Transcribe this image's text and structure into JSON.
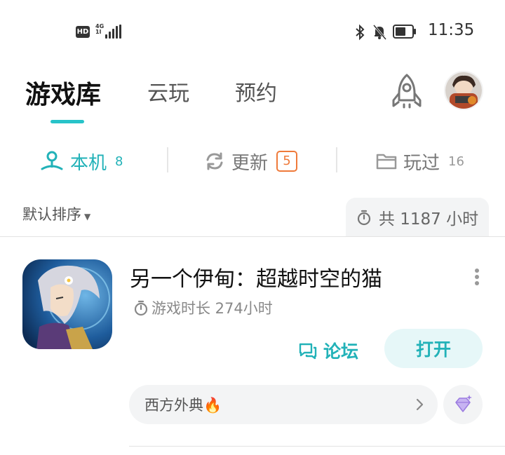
{
  "status_bar": {
    "hd_label": "HD",
    "network_label": "4G",
    "network_sub": "1l",
    "time": "11:35"
  },
  "top_tabs": [
    {
      "label": "游戏库",
      "active": true
    },
    {
      "label": "云玩",
      "active": false
    },
    {
      "label": "预约",
      "active": false
    }
  ],
  "sub_tabs": [
    {
      "label": "本机",
      "count": "8",
      "icon": "local-device-icon",
      "active": true
    },
    {
      "label": "更新",
      "count": "5",
      "icon": "refresh-icon",
      "active": false
    },
    {
      "label": "玩过",
      "count": "16",
      "icon": "folder-icon",
      "active": false
    }
  ],
  "sort": {
    "label": "默认排序"
  },
  "total_playtime": "共 1187 小时",
  "game": {
    "title": "另一个伊甸：超越时空的猫",
    "playtime": "游戏时长 274小时",
    "forum_label": "论坛",
    "open_label": "打开",
    "tag_label": "西方外典🔥"
  },
  "colors": {
    "accent": "#22b2b8",
    "update_badge": "#ef7a3a",
    "tab_underline": "#27c3c9"
  }
}
